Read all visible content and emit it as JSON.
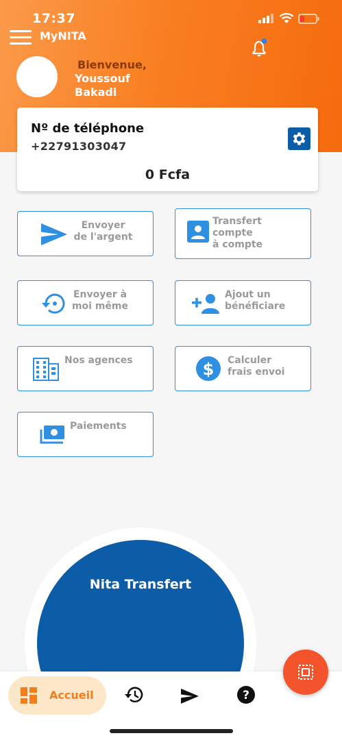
{
  "status_bar": {
    "time": "17:37"
  },
  "app": {
    "title": "MyNITA"
  },
  "user": {
    "welcome": "Bienvenue,",
    "first_name": "Youssouf",
    "last_name": "Bakadi"
  },
  "account": {
    "label": "Nº de téléphone",
    "phone": "+22791303047",
    "balance": "0 Fcfa"
  },
  "actions": [
    {
      "label": "Envoyer\nde l'argent",
      "icon": "send-icon"
    },
    {
      "label": "Transfert\ncompte\nà compte",
      "icon": "account-card-icon"
    },
    {
      "label": "Envoyer à\nmoi même",
      "icon": "restore-icon"
    },
    {
      "label": "Ajout un\nbénéficiare",
      "icon": "add-person-icon"
    },
    {
      "label": "Nos agences",
      "icon": "building-icon"
    },
    {
      "label": "Calculer\nfrais envoi",
      "icon": "dollar-icon"
    },
    {
      "label": "Paiements",
      "icon": "payments-icon"
    }
  ],
  "promo": {
    "label": "Nita Transfert"
  },
  "bottom_nav": {
    "home_label": "Accueil",
    "items": [
      "dashboard-icon",
      "history-icon",
      "send-icon",
      "help-icon"
    ]
  },
  "colors": {
    "accent": "#f97f22",
    "primary_blue": "#0c5ca8",
    "fab": "#f4542c",
    "action_border": "#2f8fe0"
  }
}
